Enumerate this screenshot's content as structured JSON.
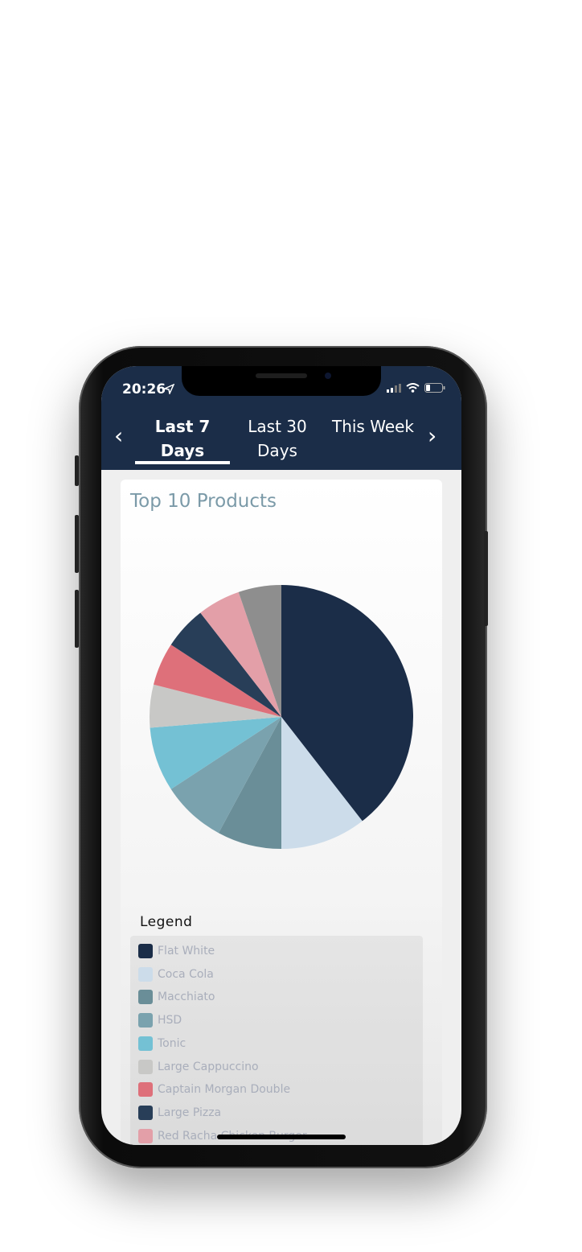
{
  "status_bar": {
    "time": "20:26",
    "location_icon": "location-arrow-icon",
    "signal_icon": "cellular-signal-icon",
    "wifi_icon": "wifi-icon",
    "battery_icon": "battery-low-icon"
  },
  "header": {
    "prev_icon": "chevron-left-icon",
    "next_icon": "chevron-right-icon",
    "tabs": [
      {
        "label": "Last 7 Days",
        "active": true
      },
      {
        "label": "Last 30 Days",
        "active": false
      },
      {
        "label": "This Week",
        "active": false
      }
    ],
    "background": "#1b2d48"
  },
  "card": {
    "title": "Top 10 Products",
    "legend_title": "Legend"
  },
  "chart_data": {
    "type": "pie",
    "title": "Top 10 Products",
    "legend_placement": "bottom",
    "slices": [
      {
        "name": "Flat White",
        "value": 15,
        "color": "#1b2d48"
      },
      {
        "name": "Coca Cola",
        "value": 4,
        "color": "#ccdcea"
      },
      {
        "name": "Macchiato",
        "value": 3,
        "color": "#6a8e98"
      },
      {
        "name": "HSD",
        "value": 3,
        "color": "#7aa2ae"
      },
      {
        "name": "Tonic",
        "value": 3,
        "color": "#74c1d4"
      },
      {
        "name": "Large Cappuccino",
        "value": 2,
        "color": "#c8c8c6"
      },
      {
        "name": "Captain Morgan Double",
        "value": 2,
        "color": "#de707a"
      },
      {
        "name": "Large Pizza",
        "value": 2,
        "color": "#283e58"
      },
      {
        "name": "Red Racha Chicken Burger",
        "value": 2,
        "color": "#e39fa8"
      },
      {
        "name": "",
        "value": 2,
        "color": "#8e8e8e"
      }
    ]
  }
}
